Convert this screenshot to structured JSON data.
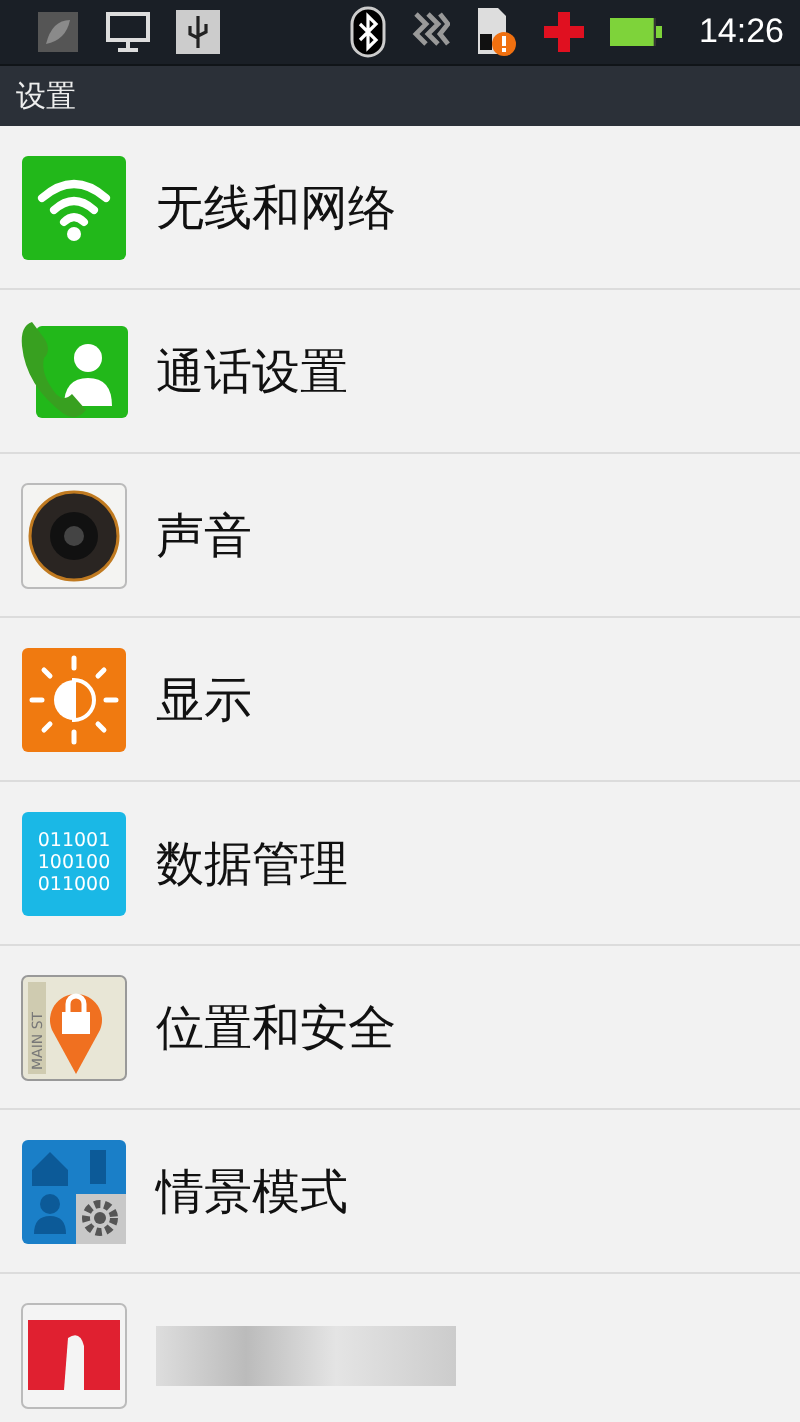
{
  "status_bar": {
    "time": "14:26",
    "battery": {
      "level": 0.95
    }
  },
  "title_bar": {
    "title": "设置"
  },
  "settings": [
    {
      "kind": "item",
      "label": "无线和网络"
    },
    {
      "kind": "item",
      "label": "通话设置"
    },
    {
      "kind": "item",
      "label": "声音"
    },
    {
      "kind": "item",
      "label": "显示"
    },
    {
      "kind": "item",
      "label": "数据管理",
      "icon_lines": [
        "011001",
        "100100",
        "011000"
      ]
    },
    {
      "kind": "item",
      "label": "位置和安全",
      "icon_lines": [
        "MAIN ST"
      ]
    },
    {
      "kind": "item",
      "label": "情景模式"
    },
    {
      "kind": "blurred"
    }
  ]
}
